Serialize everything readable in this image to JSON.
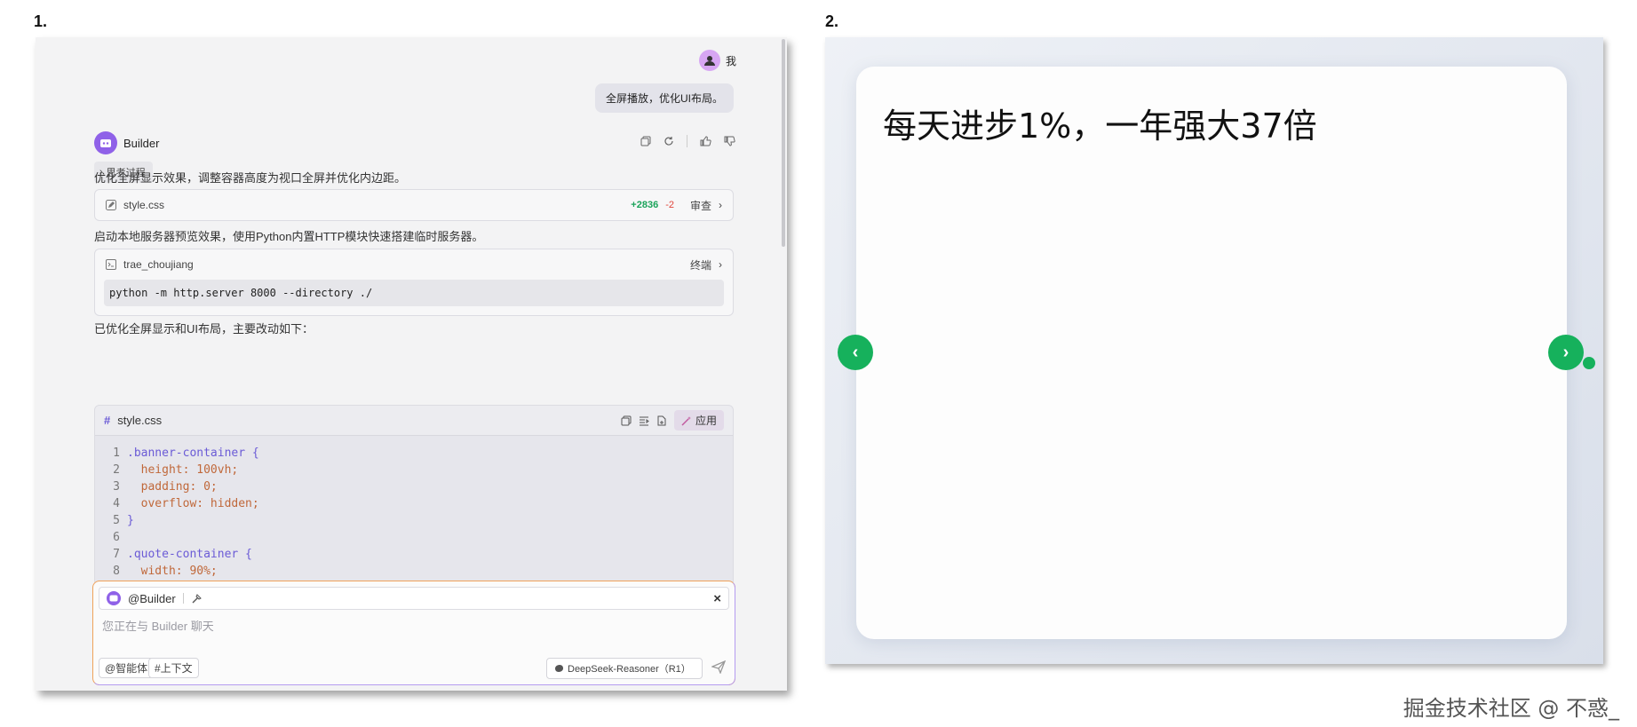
{
  "labels": {
    "panel1": "1.",
    "panel2": "2."
  },
  "chat": {
    "user_name": "我",
    "user_message": "全屏播放，优化UI布局。",
    "bot_name": "Builder",
    "thinking_label": "思考过程",
    "para1": "优化全屏显示效果，调整容器高度为视口全屏并优化内边距。",
    "file_card": {
      "filename": "style.css",
      "added": "+2836",
      "removed": "-2",
      "action": "审查"
    },
    "para2": "启动本地服务器预览效果，使用Python内置HTTP模块快速搭建临时服务器。",
    "terminal_card": {
      "name": "trae_choujiang",
      "action": "终端",
      "command": "python -m http.server 8000 --directory ./"
    },
    "para3": "已优化全屏显示和UI布局，主要改动如下：",
    "code_card": {
      "filename": "style.css",
      "apply_label": "应用",
      "line_numbers": [
        "1",
        "2",
        "3",
        "4",
        "5",
        "6",
        "7",
        "8"
      ],
      "lines": [
        ".banner-container {",
        "  height: 100vh;",
        "  padding: 0;",
        "  overflow: hidden;",
        "}",
        "",
        ".quote-container {",
        "  width: 90%;"
      ]
    },
    "input": {
      "agent": "@Builder",
      "placeholder": "您正在与 Builder 聊天",
      "chip_agent": "@智能体",
      "chip_context": "#上下文",
      "model": "DeepSeek-Reasoner（R1）"
    }
  },
  "preview": {
    "quote": "每天进步1%，一年强大37倍",
    "prev_symbol": "‹",
    "next_symbol": "›"
  },
  "watermark": "掘金技术社区 @ 不惑_",
  "colors": {
    "accent_green": "#16b15c",
    "accent_purple": "#8f61e8",
    "diff_add": "#1aa35a",
    "diff_remove": "#e0443a"
  }
}
